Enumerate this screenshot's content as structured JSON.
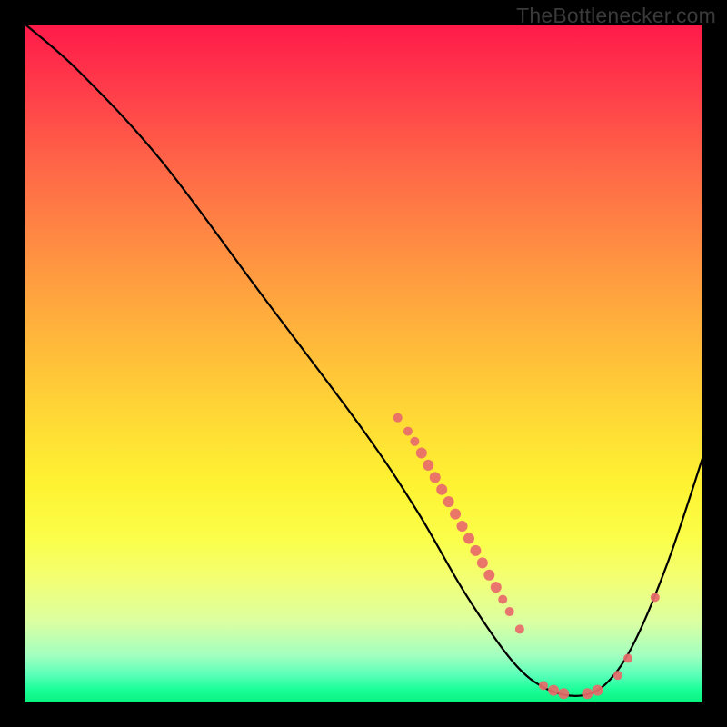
{
  "watermark": {
    "text": "TheBottlenecker.com"
  },
  "chart_data": {
    "type": "line",
    "title": "",
    "xlabel": "",
    "ylabel": "",
    "xlim": [
      0,
      100
    ],
    "ylim": [
      0,
      100
    ],
    "curve": [
      {
        "x": 0,
        "y": 100
      },
      {
        "x": 8,
        "y": 93
      },
      {
        "x": 20,
        "y": 80
      },
      {
        "x": 35,
        "y": 60
      },
      {
        "x": 50,
        "y": 40
      },
      {
        "x": 58,
        "y": 28
      },
      {
        "x": 65,
        "y": 16
      },
      {
        "x": 72,
        "y": 6
      },
      {
        "x": 77,
        "y": 2
      },
      {
        "x": 82,
        "y": 1
      },
      {
        "x": 86,
        "y": 3
      },
      {
        "x": 90,
        "y": 9
      },
      {
        "x": 95,
        "y": 21
      },
      {
        "x": 100,
        "y": 36
      }
    ],
    "scatter_points": [
      {
        "x": 55.0,
        "y": 42.0,
        "r": 5
      },
      {
        "x": 56.5,
        "y": 40.0,
        "r": 5
      },
      {
        "x": 57.5,
        "y": 38.5,
        "r": 5
      },
      {
        "x": 58.5,
        "y": 36.8,
        "r": 6
      },
      {
        "x": 59.5,
        "y": 35.0,
        "r": 6
      },
      {
        "x": 60.5,
        "y": 33.2,
        "r": 6
      },
      {
        "x": 61.5,
        "y": 31.4,
        "r": 6
      },
      {
        "x": 62.5,
        "y": 29.6,
        "r": 6
      },
      {
        "x": 63.5,
        "y": 27.8,
        "r": 6
      },
      {
        "x": 64.5,
        "y": 26.0,
        "r": 6
      },
      {
        "x": 65.5,
        "y": 24.2,
        "r": 6
      },
      {
        "x": 66.5,
        "y": 22.4,
        "r": 6
      },
      {
        "x": 67.5,
        "y": 20.6,
        "r": 6
      },
      {
        "x": 68.5,
        "y": 18.8,
        "r": 6
      },
      {
        "x": 69.5,
        "y": 17.0,
        "r": 6
      },
      {
        "x": 70.5,
        "y": 15.2,
        "r": 5
      },
      {
        "x": 71.5,
        "y": 13.4,
        "r": 5
      },
      {
        "x": 73.0,
        "y": 10.8,
        "r": 5
      },
      {
        "x": 76.5,
        "y": 2.5,
        "r": 5
      },
      {
        "x": 78.0,
        "y": 1.8,
        "r": 6
      },
      {
        "x": 79.5,
        "y": 1.3,
        "r": 6
      },
      {
        "x": 83.0,
        "y": 1.3,
        "r": 6
      },
      {
        "x": 84.5,
        "y": 1.8,
        "r": 6
      },
      {
        "x": 87.5,
        "y": 4.0,
        "r": 5
      },
      {
        "x": 89.0,
        "y": 6.5,
        "r": 5
      },
      {
        "x": 93.0,
        "y": 15.5,
        "r": 5
      }
    ],
    "colors": {
      "curve": "#000000",
      "scatter": "#e86a6a"
    }
  }
}
